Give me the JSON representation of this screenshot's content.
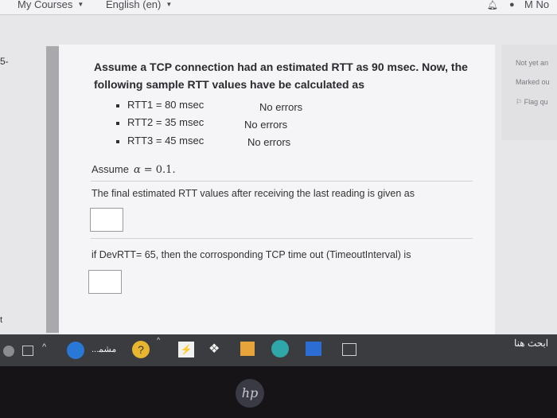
{
  "navbar": {
    "my_courses": "My Courses",
    "language": "English (en)",
    "user_initials": "M No"
  },
  "question": {
    "number": "5-",
    "title_line1": "Assume a TCP connection had an estimated RTT as 90 msec. Now, the",
    "title_line2": "following sample RTT values have be calculated as",
    "samples": [
      {
        "label": "RTT1 = 80 msec",
        "status": "No errors"
      },
      {
        "label": "RTT2 = 35 msec",
        "status": "No errors"
      },
      {
        "label": "RTT3 = 45 msec",
        "status": "No errors"
      }
    ],
    "assume_prefix": "Assume",
    "alpha_symbol": "α",
    "alpha_value": "= 0.1.",
    "final_prompt": "The final estimated RTT values after receiving the last reading is given as",
    "devrtt_prompt": "if DevRTT= 65, then the corrosponding TCP time out (TimeoutInterval) is",
    "answer1_value": "",
    "answer2_value": ""
  },
  "info_panel": {
    "status": "Not yet an",
    "marked": "Marked ou",
    "flag": "Flag qu"
  },
  "left_margin_char": "t",
  "taskbar": {
    "weather_text": "...ﻣﺸﻤ",
    "search_label": "ﺍﺑﺤﺚ ﻫﻨﺎ",
    "icons": [
      "settings-icon",
      "display-icon",
      "chevron-up-icon",
      "app-circle-icon",
      "help-icon",
      "power-icon",
      "dropbox-icon",
      "store-icon",
      "edge-icon",
      "app-icon",
      "taskview-icon"
    ]
  },
  "colors": {
    "screen_bg": "#e7e6e9",
    "card_bg": "#f5f4f6",
    "taskbar": "#3a3c3f",
    "strip": "#a9a8ad"
  }
}
